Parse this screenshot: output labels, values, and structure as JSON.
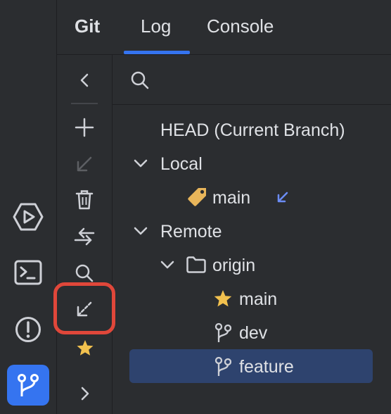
{
  "tool_window": {
    "title": "Git",
    "tabs": [
      {
        "label": "Log",
        "active": true
      },
      {
        "label": "Console",
        "active": false
      }
    ]
  },
  "branches": {
    "head": "HEAD (Current Branch)",
    "local_group": "Local",
    "local_items": [
      {
        "name": "main",
        "icon": "tag-icon",
        "incoming": true
      }
    ],
    "remote_group": "Remote",
    "remote_folder": "origin",
    "remote_items": [
      {
        "name": "main",
        "icon": "star-icon"
      },
      {
        "name": "dev",
        "icon": "branch-icon"
      },
      {
        "name": "feature",
        "icon": "branch-icon",
        "selected": true
      }
    ]
  },
  "colors": {
    "accent": "#3574f0",
    "highlight": "#e0473a",
    "tag": "#e8b55a",
    "star": "#f2c14e",
    "incoming_arrow": "#6b8cf5"
  }
}
